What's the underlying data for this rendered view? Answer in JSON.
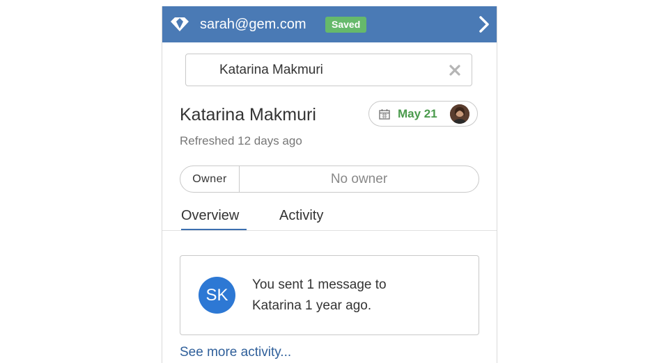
{
  "header": {
    "email": "sarah@gem.com",
    "status_badge": "Saved",
    "icons": {
      "logo": "gem-diamond-icon",
      "collapse": "chevron-right-icon"
    }
  },
  "search": {
    "value": "Katarina Makmuri",
    "clear_icon": "close-x-icon"
  },
  "contact": {
    "name": "Katarina Makmuri",
    "date": "May 21",
    "date_icon": "calendar-icon",
    "refreshed": "Refreshed 12 days ago"
  },
  "owner": {
    "label": "Owner",
    "value": "No owner"
  },
  "tabs": [
    {
      "label": "Overview",
      "active": true
    },
    {
      "label": "Activity",
      "active": false
    }
  ],
  "activity": {
    "avatar_initials": "SK",
    "message_line1": "You sent 1 message to",
    "message_line2": "Katarina 1 year ago."
  },
  "see_more": "See more activity...",
  "colors": {
    "header_bg": "#4a7ab5",
    "badge_green": "#66b96b",
    "date_green": "#4a9a4c",
    "avatar_blue": "#2d78d4",
    "link_blue": "#2f5f9a"
  }
}
